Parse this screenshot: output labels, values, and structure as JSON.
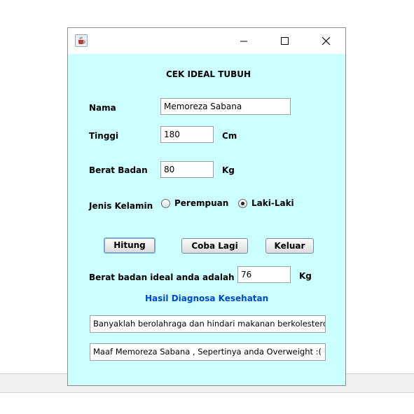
{
  "window": {
    "title": ""
  },
  "form": {
    "heading": "CEK IDEAL TUBUH",
    "nama_label": "Nama",
    "nama_value": "Memoreza Sabana",
    "tinggi_label": "Tinggi",
    "tinggi_value": "180",
    "tinggi_unit": "Cm",
    "berat_label": "Berat Badan",
    "berat_value": "80",
    "berat_unit": "Kg",
    "gender_label": "Jenis Kelamin",
    "gender_options": [
      "Perempuan",
      "Laki-Laki"
    ],
    "gender_selected": "Laki-Laki"
  },
  "buttons": {
    "hitung": "Hitung",
    "coba_lagi": "Coba Lagi",
    "keluar": "Keluar"
  },
  "result": {
    "ideal_label": "Berat badan ideal anda adalah",
    "ideal_value": "76",
    "ideal_unit": "Kg",
    "diagnosis_heading": "Hasil Diagnosa Kesehatan",
    "advice": "Banyaklah berolahraga dan hindari makanan berkolesterol",
    "status": "Maaf Memoreza Sabana , Sepertinya anda Overweight :("
  },
  "colors": {
    "panel_bg": "#ccffff",
    "diagnosis_heading": "#0046d5"
  },
  "icons": {
    "app": "java-cup-icon",
    "minimize": "minimize-icon",
    "maximize": "maximize-icon",
    "close": "close-icon"
  }
}
